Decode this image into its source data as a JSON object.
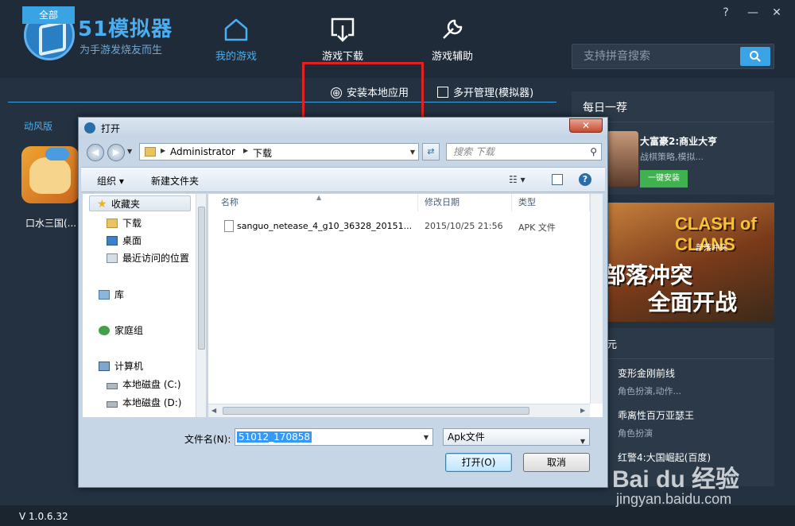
{
  "app": {
    "logo_title": "51模拟器",
    "logo_slogan": "为手游发烧友而生",
    "nav": [
      {
        "label": "我的游戏",
        "icon": "home-icon",
        "active": true
      },
      {
        "label": "游戏下载",
        "icon": "download-icon",
        "active": false
      },
      {
        "label": "游戏辅助",
        "icon": "wrench-icon",
        "active": false
      }
    ],
    "window_controls": {
      "help": "?",
      "minimize": "—",
      "close": "✕"
    },
    "search": {
      "placeholder": "支持拼音搜索",
      "icon": "search-icon"
    },
    "accent_color": "#3aa3e4"
  },
  "toolbar": {
    "tab_all": "全部",
    "install_local": "安装本地应用",
    "install_local_icon": "⊕",
    "multi_open": "多开管理(模拟器)"
  },
  "library": {
    "section_label": "动风版",
    "games": [
      {
        "name": "口水三国(..."
      }
    ]
  },
  "sidebar": {
    "daily": {
      "title": "每日一荐",
      "game_name": "大富豪2:商业大亨",
      "game_desc": "战棋策略,模拟...",
      "install_label": "一键安装"
    },
    "banner": {
      "brand": "CLASH of CLANS",
      "brand_cn": "部落冲突",
      "line1": "部落冲突",
      "line2": "全面开战"
    },
    "charts": {
      "title": "元",
      "items": [
        {
          "name": "变形金刚前线",
          "sub": "角色扮演,动作..."
        },
        {
          "name": "乖离性百万亚瑟王",
          "sub": "角色扮演"
        },
        {
          "name": "红警4:大国崛起(百度)",
          "sub": ""
        }
      ]
    }
  },
  "footer": {
    "version": "V 1.0.6.32"
  },
  "watermark": {
    "brand": "Bai du 经验",
    "url": "jingyan.baidu.com"
  },
  "dialog": {
    "title": "打开",
    "close_label": "✕",
    "address": {
      "segments": [
        "Administrator",
        "下载"
      ]
    },
    "search_placeholder": "搜索 下载",
    "commands": {
      "organize": "组织 ▾",
      "new_folder": "新建文件夹",
      "view": "☷ ▾",
      "help": "?"
    },
    "nav_tree": [
      {
        "label": "收藏夹",
        "icon": "star-icon"
      },
      {
        "label": "下载",
        "icon": "folder-icon"
      },
      {
        "label": "桌面",
        "icon": "desktop-icon"
      },
      {
        "label": "最近访问的位置",
        "icon": "recent-places-icon"
      },
      {
        "label": "库",
        "icon": "library-icon"
      },
      {
        "label": "家庭组",
        "icon": "homegroup-icon"
      },
      {
        "label": "计算机",
        "icon": "computer-icon"
      },
      {
        "label": "本地磁盘 (C:)",
        "icon": "drive-icon"
      },
      {
        "label": "本地磁盘 (D:)",
        "icon": "drive-icon"
      }
    ],
    "columns": [
      "名称",
      "修改日期",
      "类型"
    ],
    "files": [
      {
        "name": "sanguo_netease_4_g10_36328_20151...",
        "date": "2015/10/25 21:56",
        "type": "APK 文件"
      }
    ],
    "filename_label": "文件名(N):",
    "filename_value": "51012_170858",
    "file_type": "Apk文件",
    "open_label": "打开(O)",
    "cancel_label": "取消"
  }
}
